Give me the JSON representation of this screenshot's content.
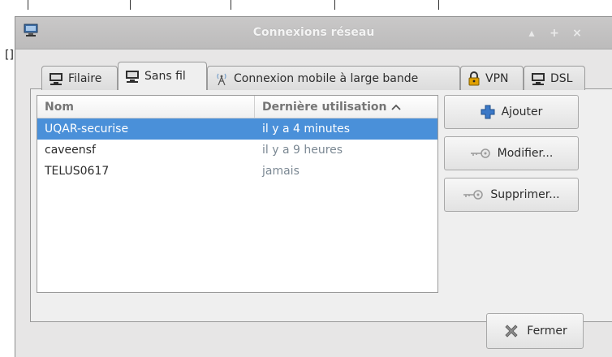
{
  "window": {
    "title": "Connexions réseau",
    "controls": {
      "minimize": "▴",
      "maximize": "+",
      "close": "×"
    }
  },
  "tabs": [
    {
      "label": "Filaire",
      "icon": "network-icon"
    },
    {
      "label": "Sans fil",
      "icon": "network-icon"
    },
    {
      "label": "Connexion mobile à large bande",
      "icon": "antenna-icon"
    },
    {
      "label": "VPN",
      "icon": "lock-icon"
    },
    {
      "label": "DSL",
      "icon": "network-icon"
    }
  ],
  "active_tab": "Sans fil",
  "list": {
    "headers": {
      "name": "Nom",
      "last_used": "Dernière utilisation"
    },
    "sort_indicator": "^",
    "rows": [
      {
        "name": "UQAR-securise",
        "last_used": "il y a 4 minutes",
        "selected": true
      },
      {
        "name": "caveensf",
        "last_used": "il y a 9 heures",
        "selected": false
      },
      {
        "name": "TELUS0617",
        "last_used": "jamais",
        "selected": false
      }
    ]
  },
  "buttons": {
    "add": "Ajouter",
    "edit": "Modifier...",
    "delete": "Supprimer...",
    "close": "Fermer"
  },
  "colors": {
    "selection": "#4a90d9",
    "add_icon": "#3b78c7",
    "vpn_icon": "#e0a000"
  }
}
